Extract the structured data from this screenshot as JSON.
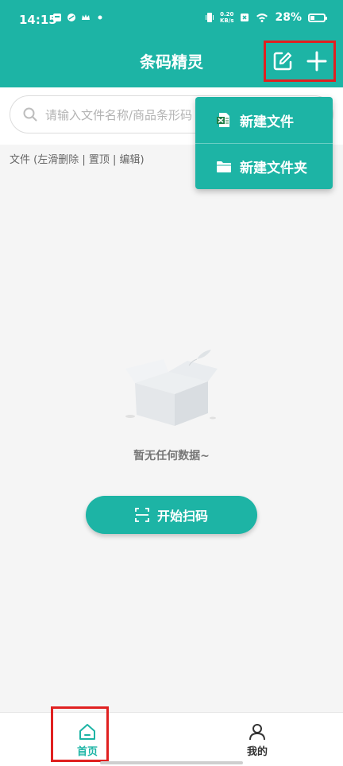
{
  "status_bar": {
    "time": "14:15",
    "net_speed_value": "0.20",
    "net_speed_unit": "KB/s",
    "battery": "28%"
  },
  "header": {
    "title": "条码精灵",
    "icons": [
      "edit-icon",
      "plus-icon"
    ]
  },
  "search": {
    "placeholder": "请输入文件名称/商品条形码"
  },
  "file_hint": "文件 (左滑删除 | 置顶 | 编辑)",
  "dropdown": {
    "items": [
      {
        "label": "新建文件",
        "icon": "excel-file-icon"
      },
      {
        "label": "新建文件夹",
        "icon": "folder-icon"
      }
    ]
  },
  "empty": {
    "text": "暂无任何数据~"
  },
  "scan_button": {
    "label": "开始扫码"
  },
  "tabbar": {
    "items": [
      {
        "label": "首页",
        "icon": "home-icon"
      },
      {
        "label": "我的",
        "icon": "user-icon"
      }
    ]
  },
  "colors": {
    "primary": "#1db4a5",
    "highlight": "#e02020",
    "background": "#f5f5f5"
  }
}
